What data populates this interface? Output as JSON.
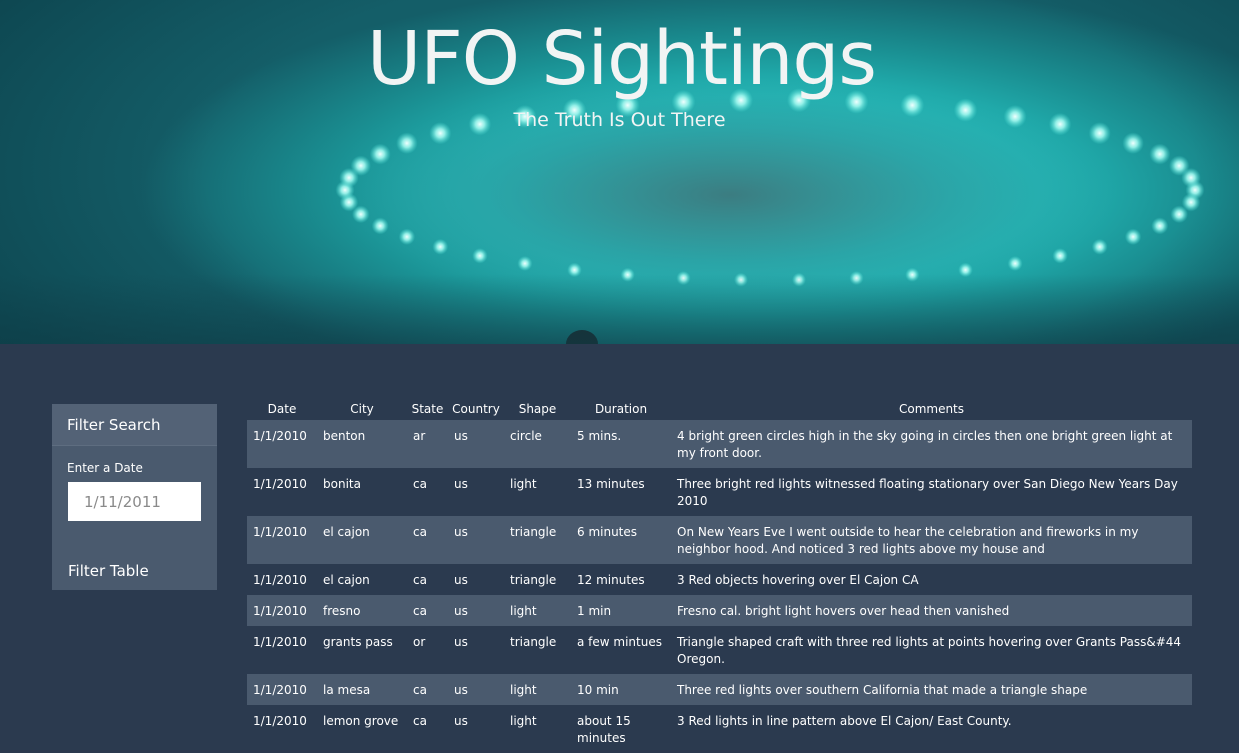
{
  "header": {
    "title": "UFO Sightings",
    "subtitle": "The Truth Is Out There"
  },
  "colors": {
    "background": "#2b3a4f",
    "panel": "#4a5a6e",
    "row_alt": "#4a5a6e",
    "hero_glow": "#2fd4cf"
  },
  "filter": {
    "heading": "Filter Search",
    "date_label": "Enter a Date",
    "date_placeholder": "1/11/2011",
    "button_label": "Filter Table"
  },
  "table": {
    "columns": [
      "Date",
      "City",
      "State",
      "Country",
      "Shape",
      "Duration",
      "Comments"
    ],
    "rows": [
      [
        "1/1/2010",
        "benton",
        "ar",
        "us",
        "circle",
        "5 mins.",
        "4 bright green circles high in the sky going in circles then one bright green light at my front door."
      ],
      [
        "1/1/2010",
        "bonita",
        "ca",
        "us",
        "light",
        "13 minutes",
        "Three bright red lights witnessed floating stationary over San Diego New Years Day 2010"
      ],
      [
        "1/1/2010",
        "el cajon",
        "ca",
        "us",
        "triangle",
        "6 minutes",
        "On New Years Eve I went outside to hear the celebration and fireworks in my neighbor hood. And noticed 3 red lights above my house and"
      ],
      [
        "1/1/2010",
        "el cajon",
        "ca",
        "us",
        "triangle",
        "12 minutes",
        "3 Red objects hovering over El Cajon CA"
      ],
      [
        "1/1/2010",
        "fresno",
        "ca",
        "us",
        "light",
        "1 min",
        "Fresno cal. bright light hovers over head then vanished"
      ],
      [
        "1/1/2010",
        "grants pass",
        "or",
        "us",
        "triangle",
        "a few mintues",
        "Triangle shaped craft with three red lights at points hovering over Grants Pass&#44 Oregon."
      ],
      [
        "1/1/2010",
        "la mesa",
        "ca",
        "us",
        "light",
        "10 min",
        "Three red lights over southern California that made a triangle shape"
      ],
      [
        "1/1/2010",
        "lemon grove",
        "ca",
        "us",
        "light",
        "about 15 minutes",
        "3 Red lights in line pattern above El Cajon/ East County."
      ]
    ]
  }
}
